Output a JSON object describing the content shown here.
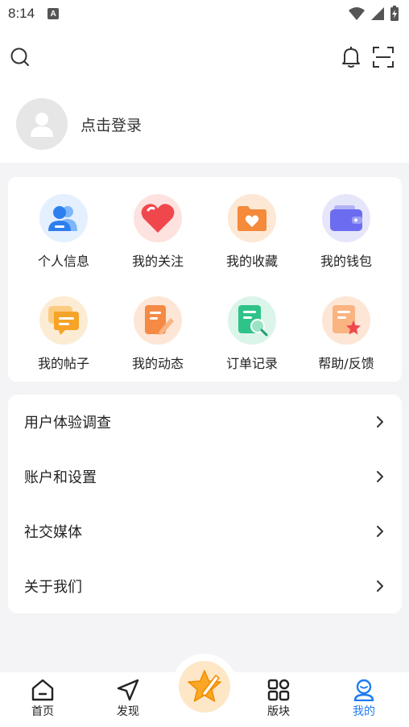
{
  "status_bar": {
    "time": "8:14",
    "a_badge": "A"
  },
  "header": {
    "search_icon": "search-icon",
    "bell_icon": "bell-icon",
    "scan_icon": "scan-icon"
  },
  "profile": {
    "login_label": "点击登录"
  },
  "grid": {
    "items": [
      {
        "label": "个人信息",
        "icon": "user-group-icon",
        "color": "#3a8ef6"
      },
      {
        "label": "我的关注",
        "icon": "heart-icon",
        "color": "#f0474d"
      },
      {
        "label": "我的收藏",
        "icon": "folder-heart-icon",
        "color": "#f48a3a"
      },
      {
        "label": "我的钱包",
        "icon": "wallet-icon",
        "color": "#6b6cf0"
      },
      {
        "label": "我的帖子",
        "icon": "chat-icon",
        "color": "#f6a328"
      },
      {
        "label": "我的动态",
        "icon": "edit-doc-icon",
        "color": "#f58a45"
      },
      {
        "label": "订单记录",
        "icon": "order-search-icon",
        "color": "#2fc38a"
      },
      {
        "label": "帮助/反馈",
        "icon": "doc-star-icon",
        "color": "#f58a45"
      }
    ]
  },
  "menu": {
    "items": [
      {
        "label": "用户体验调查"
      },
      {
        "label": "账户和设置"
      },
      {
        "label": "社交媒体"
      },
      {
        "label": "关于我们"
      }
    ]
  },
  "tabs": {
    "items": [
      {
        "label": "首页",
        "icon": "home-icon"
      },
      {
        "label": "发现",
        "icon": "navigation-icon"
      },
      {
        "label": "版块",
        "icon": "grid-icon"
      },
      {
        "label": "我的",
        "icon": "profile-icon",
        "active": true
      }
    ],
    "center_icon": "star-pen-icon",
    "active_color": "#1e7cf2"
  }
}
